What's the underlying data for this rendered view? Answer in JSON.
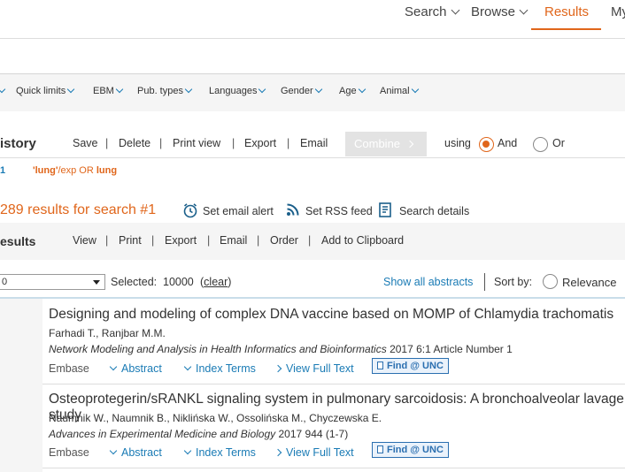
{
  "nav": {
    "search": "Search",
    "browse": "Browse",
    "results": "Results",
    "my": "My"
  },
  "limits": [
    "Quick limits",
    "EBM",
    "Pub. types",
    "Languages",
    "Gender",
    "Age",
    "Animal"
  ],
  "history": {
    "title": "istory",
    "tools": [
      "Save",
      "Delete",
      "Print view",
      "Export",
      "Email"
    ],
    "combine": "Combine",
    "using": "using",
    "and": "And",
    "or": "Or",
    "row_num": "1",
    "row_q_term1": "'lung'",
    "row_q_mid": "/exp OR ",
    "row_q_term2": "lung"
  },
  "results_count": {
    "text": "289 results for search #1",
    "email_alert": "Set email alert",
    "rss": "Set RSS feed",
    "details": "Search details"
  },
  "results_bar": {
    "title": "esults",
    "tools": [
      "View",
      "Print",
      "Export",
      "Email",
      "Order",
      "Add to Clipboard"
    ]
  },
  "selection": {
    "dropdown_value": "0",
    "selected_label": "Selected:",
    "selected_count": "10000",
    "clear": "clear",
    "show_all": "Show all abstracts",
    "sort_by": "Sort by:",
    "relevance": "Relevance"
  },
  "records": [
    {
      "title": "Designing and modeling of complex DNA vaccine based on MOMP of Chlamydia trachomatis",
      "authors": "Farhadi T., Ranjbar M.M.",
      "journal": "Network Modeling and Analysis in Health Informatics and Bioinformatics",
      "source_rest": " 2017 6:1 Article Number 1",
      "db": "Embase",
      "abstract": "Abstract",
      "index_terms": "Index Terms",
      "full_text": "View Full Text",
      "find": "Find @ UNC"
    },
    {
      "title": "Osteoprotegerin/sRANKL signaling system in pulmonary sarcoidosis: A bronchoalveolar lavage study",
      "authors": "Naumnik W., Naumnik B., Niklińska W., Ossolińska M., Chyczewska E.",
      "journal": "Advances in Experimental Medicine and Biology",
      "source_rest": " 2017 944 (1-7)",
      "db": "Embase",
      "abstract": "Abstract",
      "index_terms": "Index Terms",
      "full_text": "View Full Text",
      "find": "Find @ UNC"
    }
  ]
}
